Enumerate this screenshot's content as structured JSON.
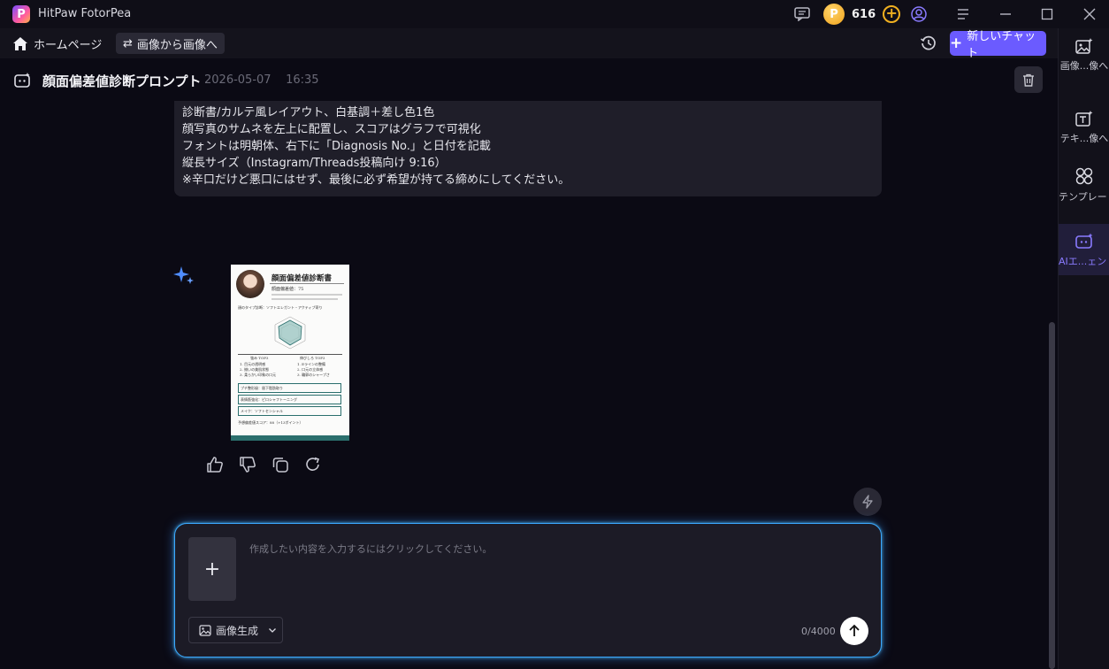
{
  "app": {
    "title": "HitPaw FotorPea",
    "credits": "616",
    "logo_letter": "P"
  },
  "nav": {
    "home_label": "ホームページ",
    "mode_label": "画像から画像へ",
    "new_chat_label": "新しいチャット"
  },
  "chat": {
    "title": "顔面偏差値診断プロンプト",
    "date": "2026-05-07",
    "time": "16:35"
  },
  "message": {
    "lines": [
      "診断書/カルテ風レイアウト、白基調＋差し色1色",
      "顔写真のサムネを左上に配置し、スコアはグラフで可視化",
      "フォントは明朝体、右下に「Diagnosis No.」と日付を記載",
      "縦長サイズ（Instagram/Threads投稿向け 9:16）",
      "※辛口だけど悪口にはせず、最後に必ず希望が持てる締めにしてください。"
    ]
  },
  "result_card": {
    "title": "顔面偏差値診断書",
    "score_line": "顔面偏差値：75",
    "type_line": "顔のタイプ診断：ソフトエレガント・アクティブ寄り",
    "strengths_header": "強み TOP3",
    "strengths": [
      "1. 目元の透明感",
      "2. 揃いの美肌状態",
      "3. 柔らかい印象の口元"
    ],
    "improve_header": "伸びしろ TOP3",
    "improve": [
      "1. Eラインの整備",
      "2. 口元の立体感",
      "3. 輪郭のシャープさ"
    ],
    "advice": [
      "プチ整形級：眉下脂肪取り",
      "表情筋強化：ピロシャフトーニング",
      "メイク：ソフトセンシャル"
    ],
    "potential_line": "予想偏差値スコア：88（+13ポイント）"
  },
  "input": {
    "placeholder": "作成したい内容を入力するにはクリックしてください。",
    "mode_label": "画像生成",
    "char_count": "0/4000"
  },
  "sidebar": {
    "items": [
      {
        "label": "画像...像へ",
        "icon": "image-sparkle-icon"
      },
      {
        "label": "テキ...像へ",
        "icon": "text-sparkle-icon"
      },
      {
        "label": "テンプレート",
        "icon": "template-icon"
      },
      {
        "label": "AIエ...ェント",
        "icon": "ai-agent-icon"
      }
    ]
  },
  "colors": {
    "accent": "#6b5bff",
    "input_glow": "#3aa8ff",
    "background": "#0b0a14",
    "coin": "#f0a21b"
  }
}
